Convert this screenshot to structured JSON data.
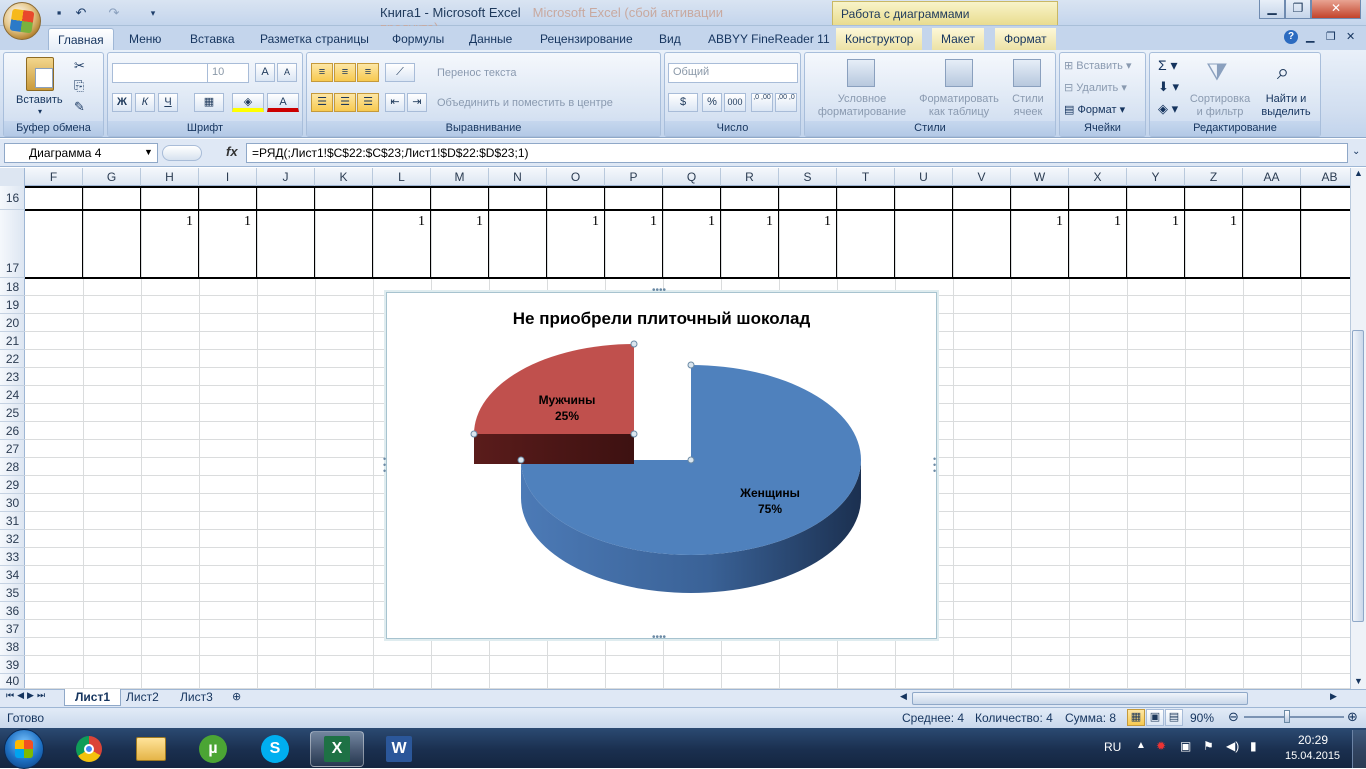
{
  "window": {
    "title": "Книга1 - Microsoft Excel",
    "ghost_title": "Microsoft Excel (сбой активации продукта)",
    "context_tab": "Работа с диаграммами"
  },
  "tabs": [
    "Главная",
    "Меню",
    "Вставка",
    "Разметка страницы",
    "Формулы",
    "Данные",
    "Рецензирование",
    "Вид",
    "ABBYY FineReader 11",
    "Конструктор",
    "Макет",
    "Формат"
  ],
  "ribbon": {
    "clipboard": {
      "label": "Буфер обмена",
      "paste": "Вставить"
    },
    "font": {
      "label": "Шрифт",
      "size": "10",
      "bold": "Ж",
      "italic": "К",
      "underline": "Ч"
    },
    "alignment": {
      "label": "Выравнивание",
      "wrap": "Перенос текста",
      "merge": "Объединить и поместить в центре"
    },
    "number": {
      "label": "Число",
      "format": "Общий",
      "percent": "%",
      "thousands": "000",
      "inc": ",0 ,00",
      "dec": ",00 ,0"
    },
    "styles": {
      "label": "Стили",
      "conditional": "Условное форматирование",
      "table": "Форматировать как таблицу",
      "cell": "Стили ячеек"
    },
    "cells": {
      "label": "Ячейки",
      "insert": "Вставить",
      "delete": "Удалить",
      "format": "Формат"
    },
    "editing": {
      "label": "Редактирование",
      "sort": "Сортировка и фильтр",
      "find": "Найти и выделить"
    }
  },
  "formula_bar": {
    "name_box": "Диаграмма 4",
    "fx": "fx",
    "formula": "=РЯД(;Лист1!$C$22:$C$23;Лист1!$D$22:$D$23;1)"
  },
  "columns": [
    "F",
    "G",
    "H",
    "I",
    "J",
    "K",
    "L",
    "M",
    "N",
    "O",
    "P",
    "Q",
    "R",
    "S",
    "T",
    "U",
    "V",
    "W",
    "X",
    "Y",
    "Z",
    "AA",
    "AB"
  ],
  "rows": [
    "16",
    "17",
    "18",
    "19",
    "20",
    "21",
    "22",
    "23",
    "24",
    "25",
    "26",
    "27",
    "28",
    "29",
    "30",
    "31",
    "32",
    "33",
    "34",
    "35",
    "36",
    "37",
    "38",
    "39",
    "40"
  ],
  "row17_values": {
    "H": "1",
    "I": "1",
    "L": "1",
    "M": "1",
    "O": "1",
    "P": "1",
    "Q": "1",
    "R": "1",
    "S": "1",
    "W": "1",
    "X": "1",
    "Y": "1",
    "Z": "1"
  },
  "chart_data": {
    "type": "pie",
    "title": "Не приобрели плиточный шоколад",
    "categories": [
      "Мужчины",
      "Женщины"
    ],
    "values": [
      25,
      75
    ],
    "labels": [
      "25%",
      "75%"
    ],
    "colors": [
      "#c0504d",
      "#4f81bd"
    ],
    "exploded": "Мужчины",
    "style": "3d"
  },
  "sheets": [
    "Лист1",
    "Лист2",
    "Лист3"
  ],
  "status": {
    "ready": "Готово",
    "avg": "Среднее: 4",
    "count": "Количество: 4",
    "sum": "Сумма: 8",
    "zoom": "90%"
  },
  "taskbar": {
    "lang": "RU",
    "time": "20:29",
    "date": "15.04.2015"
  }
}
